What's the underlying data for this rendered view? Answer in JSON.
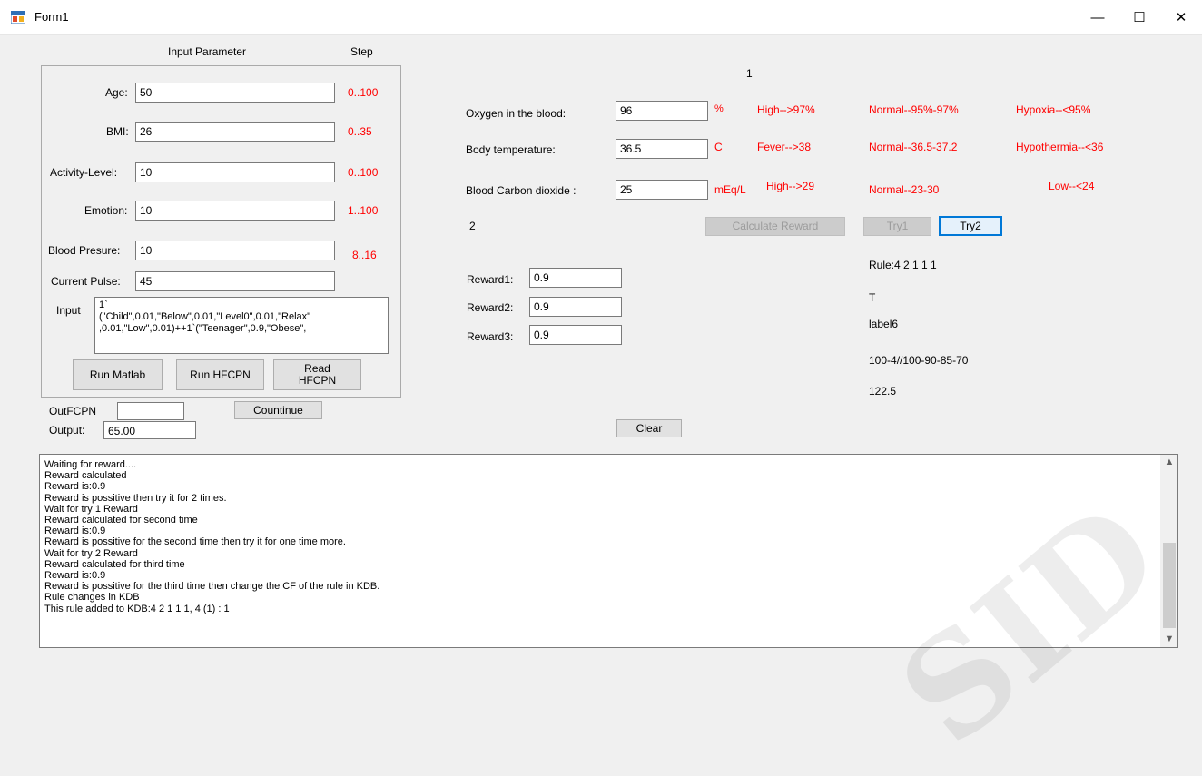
{
  "window": {
    "title": "Form1"
  },
  "titlebar": {
    "minimize": "—",
    "maximize": "☐",
    "close": "✕"
  },
  "input_panel": {
    "header_param": "Input Parameter",
    "header_step": "Step",
    "age": {
      "label": "Age:",
      "value": "50",
      "range": "0..100"
    },
    "bmi": {
      "label": "BMI:",
      "value": "26",
      "range": "0..35"
    },
    "activity": {
      "label": "Activity-Level:",
      "value": "10",
      "range": "0..100"
    },
    "emotion": {
      "label": "Emotion:",
      "value": "10",
      "range": "1..100"
    },
    "blood_pressure": {
      "label": "Blood Presure:",
      "value": "10",
      "range": "8..16"
    },
    "current_pulse": {
      "label": "Current Pulse:",
      "value": "45"
    },
    "input": {
      "label": "Input",
      "value": "1`\n(\"Child\",0.01,\"Below\",0.01,\"Level0\",0.01,\"Relax\"\n,0.01,\"Low\",0.01)++1`(\"Teenager\",0.9,\"Obese\","
    },
    "run_matlab": "Run Matlab",
    "run_hfcpn": "Run HFCPN",
    "read_hfcpn": "Read\nHFCPN"
  },
  "outfcpn": {
    "label": "OutFCPN",
    "value": ""
  },
  "countinue": "Countinue",
  "output": {
    "label": "Output:",
    "value": "65.00"
  },
  "vitals": {
    "counter1": "1",
    "oxygen": {
      "label": "Oxygen in the blood:",
      "value": "96",
      "unit": "%",
      "high": "High-->97%",
      "normal": "Normal--95%-97%",
      "low": "Hypoxia--<95%"
    },
    "temperature": {
      "label": "Body temperature:",
      "value": "36.5",
      "unit": "C",
      "high": "Fever-->38",
      "normal": "Normal--36.5-37.2",
      "low": "Hypothermia--<36"
    },
    "co2": {
      "label": "Blood Carbon dioxide :",
      "value": "25",
      "unit": "mEq/L",
      "high": "High-->29",
      "normal": "Normal--23-30",
      "low": "Low--<24"
    },
    "counter2": "2"
  },
  "actions": {
    "calculate_reward": "Calculate Reward",
    "try1": "Try1",
    "try2": "Try2",
    "clear": "Clear"
  },
  "rewards": {
    "r1": {
      "label": "Reward1:",
      "value": "0.9"
    },
    "r2": {
      "label": "Reward2:",
      "value": "0.9"
    },
    "r3": {
      "label": "Reward3:",
      "value": "0.9"
    }
  },
  "info": {
    "rule": "Rule:4 2 1 1 1",
    "t": "T",
    "label6": "label6",
    "scores": "100-4//100-90-85-70",
    "value": "122.5"
  },
  "log": {
    "lines": [
      "Waiting for reward....",
      "Reward calculated",
      "Reward is:0.9",
      "Reward is possitive then try it for 2 times.",
      "Wait for try 1 Reward",
      "Reward calculated for second time",
      "Reward is:0.9",
      "Reward is possitive for the second time then try it for one time more.",
      "Wait for try 2 Reward",
      "Reward calculated for third time",
      "Reward is:0.9",
      "Reward is possitive for the third time then change the CF of the rule in KDB.",
      "Rule changes in KDB",
      "This rule added to KDB:4 2 1 1 1, 4 (1) : 1"
    ]
  },
  "watermark": "SID"
}
